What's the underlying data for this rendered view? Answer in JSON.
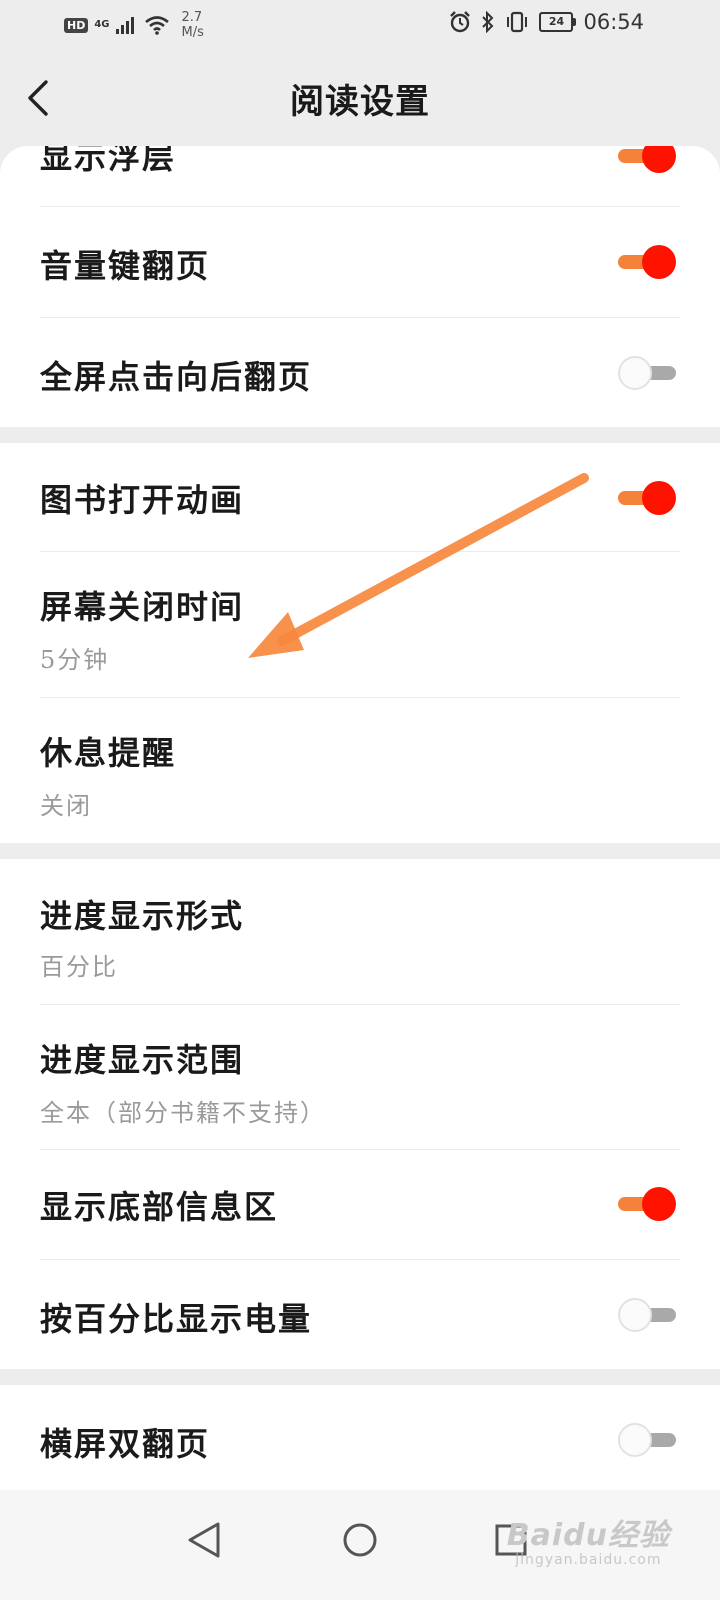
{
  "status_bar": {
    "hd": "HD",
    "network": "4G",
    "speed_value": "2.7",
    "speed_unit": "M/s",
    "battery": "24",
    "time": "06:54"
  },
  "header": {
    "title": "阅读设置",
    "back_icon": "chevron-left-icon"
  },
  "sections": [
    {
      "items": [
        {
          "title": "显示浮层",
          "toggle": true
        },
        {
          "title": "音量键翻页",
          "toggle": true
        },
        {
          "title": "全屏点击向后翻页",
          "toggle": false
        }
      ]
    },
    {
      "items": [
        {
          "title": "图书打开动画",
          "toggle": true
        },
        {
          "title": "屏幕关闭时间",
          "value": "5分钟"
        },
        {
          "title": "休息提醒",
          "value": "关闭"
        }
      ]
    },
    {
      "items": [
        {
          "title": "进度显示形式",
          "value": "百分比"
        },
        {
          "title": "进度显示范围",
          "value": "全本（部分书籍不支持）"
        },
        {
          "title": "显示底部信息区",
          "toggle": true
        },
        {
          "title": "按百分比显示电量",
          "toggle": false
        }
      ]
    },
    {
      "items": [
        {
          "title": "横屏双翻页",
          "toggle": false
        }
      ]
    }
  ],
  "annotation": {
    "arrow_color": "#f7883c",
    "points_to": "屏幕关闭时间"
  },
  "nav_bar": {
    "back_icon": "triangle-back-icon",
    "home_icon": "circle-home-icon",
    "recent_icon": "square-recent-icon"
  },
  "watermark": {
    "text": "Baidu经验",
    "url": "jingyan.baidu.com"
  },
  "colors": {
    "toggle_on_track": "#f4823a",
    "toggle_on_knob": "#ff1200",
    "toggle_off_track": "#a9a9a9",
    "subtitle": "#9a9a9a"
  }
}
